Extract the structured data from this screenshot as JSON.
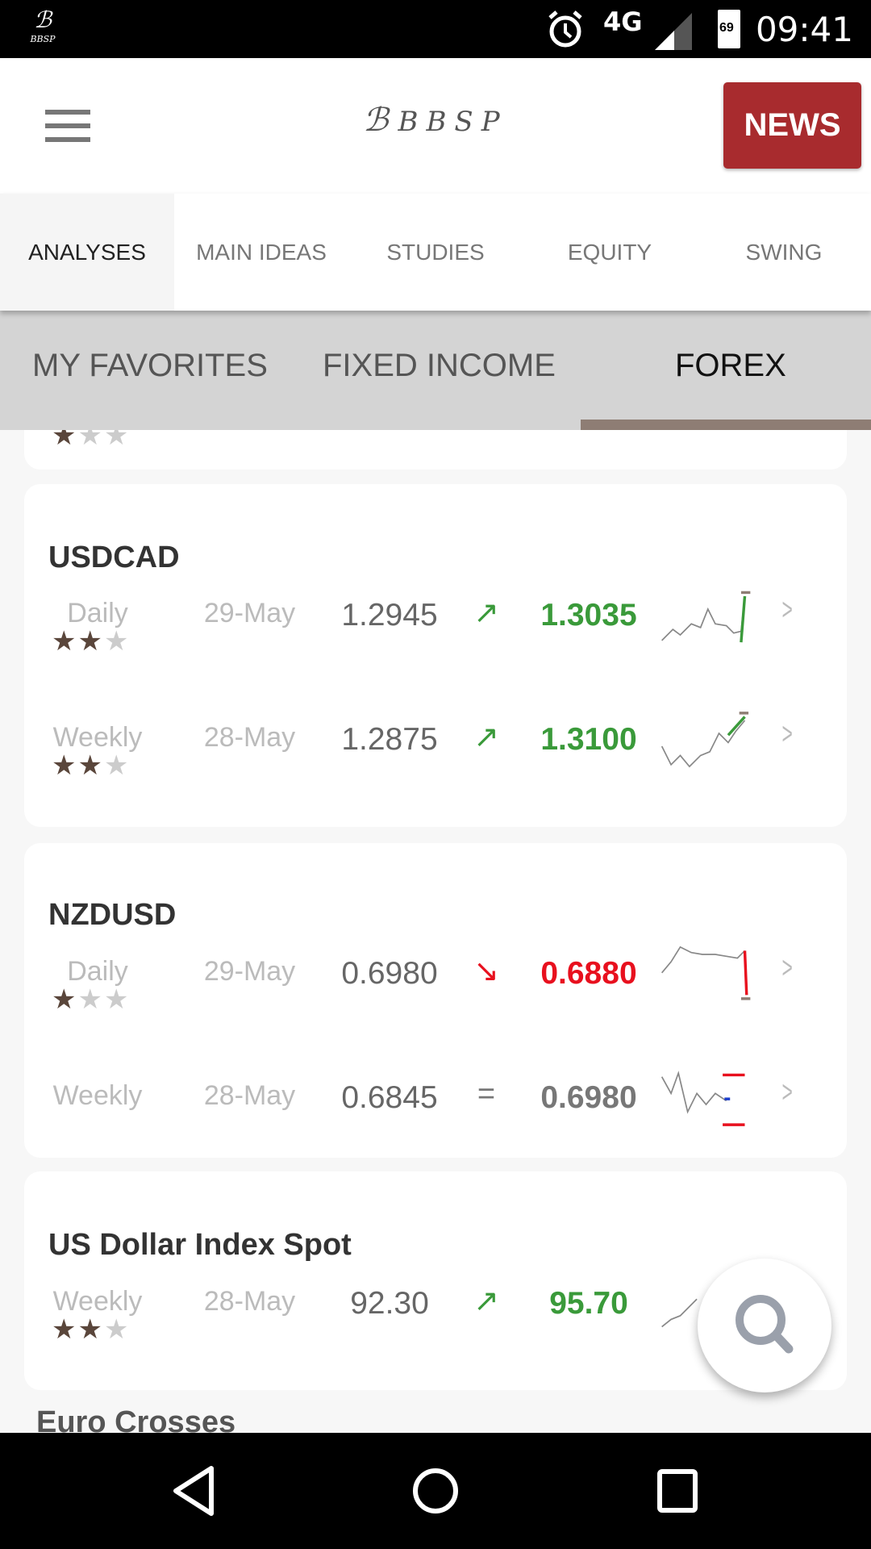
{
  "status_bar": {
    "network": "4G",
    "battery": "69",
    "time": "09:41",
    "app_logo": "BBSP"
  },
  "header": {
    "logo": "BBSP",
    "news_label": "NEWS",
    "menu_icon": "hamburger-icon"
  },
  "tabs": [
    {
      "label": "ANALYSES",
      "active": true
    },
    {
      "label": "MAIN IDEAS",
      "active": false
    },
    {
      "label": "STUDIES",
      "active": false
    },
    {
      "label": "EQUITY",
      "active": false
    },
    {
      "label": "SWING",
      "active": false
    }
  ],
  "subtabs": [
    {
      "label": "MY FAVORITES",
      "active": false
    },
    {
      "label": "FIXED INCOME",
      "active": false
    },
    {
      "label": "FOREX",
      "active": true
    }
  ],
  "colors": {
    "up": "#3a9a3a",
    "down": "#e8101e",
    "flat": "#777777",
    "news": "#a82b2e",
    "star": "#5a463b"
  },
  "partial_card": {
    "stars": 1
  },
  "cards": [
    {
      "title": "USDCAD",
      "rows": [
        {
          "period": "Daily",
          "date": "29-May",
          "value": "1.2945",
          "trend": "up",
          "target": "1.3035",
          "stars": 2
        },
        {
          "period": "Weekly",
          "date": "28-May",
          "value": "1.2875",
          "trend": "up",
          "target": "1.3100",
          "stars": 2
        }
      ]
    },
    {
      "title": "NZDUSD",
      "rows": [
        {
          "period": "Daily",
          "date": "29-May",
          "value": "0.6980",
          "trend": "down",
          "target": "0.6880",
          "stars": 1
        },
        {
          "period": "Weekly",
          "date": "28-May",
          "value": "0.6845",
          "trend": "flat",
          "target": "0.6980",
          "stars": null
        }
      ]
    },
    {
      "title": "US Dollar Index Spot",
      "rows": [
        {
          "period": "Weekly",
          "date": "28-May",
          "value": "92.30",
          "trend": "up",
          "target": "95.70",
          "stars": 2
        }
      ]
    }
  ],
  "section_next": "Euro Crosses",
  "fab": {
    "icon": "search-icon"
  }
}
